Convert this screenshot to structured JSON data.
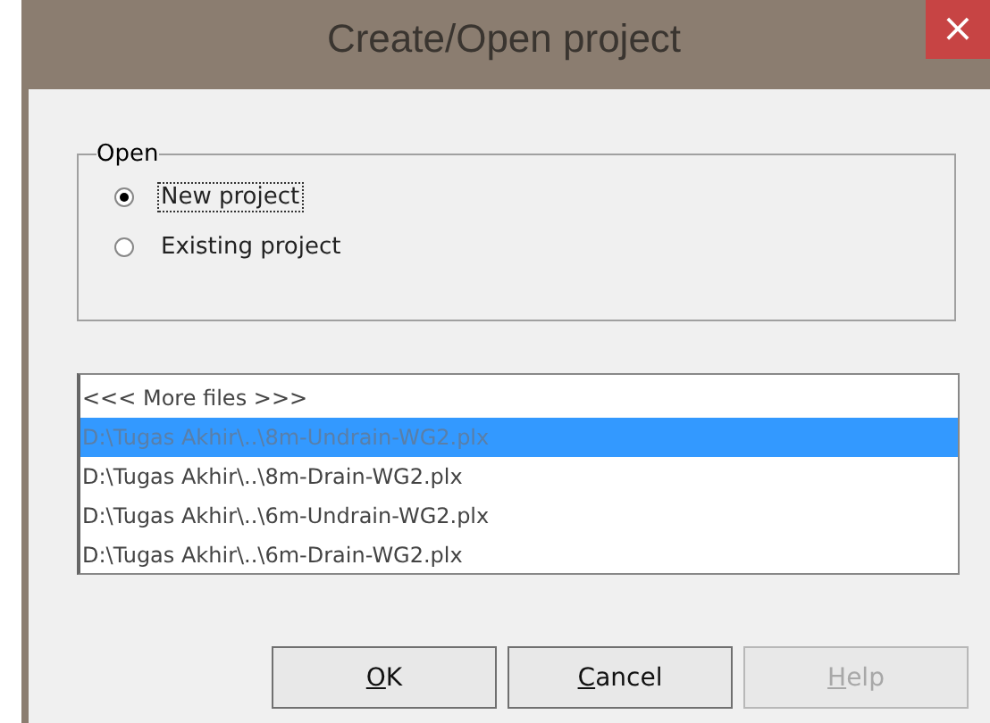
{
  "window": {
    "title": "Create/Open project",
    "close": "×"
  },
  "group": {
    "label": "Open",
    "options": [
      {
        "label": "New project",
        "selected": true,
        "focused": true
      },
      {
        "label": "Existing project",
        "selected": false,
        "focused": false
      }
    ]
  },
  "files": [
    {
      "label": "<<< More files >>>",
      "selected": false
    },
    {
      "label": "D:\\Tugas Akhir\\..\\8m-Undrain-WG2.plx",
      "selected": true
    },
    {
      "label": "D:\\Tugas Akhir\\..\\8m-Drain-WG2.plx",
      "selected": false
    },
    {
      "label": "D:\\Tugas Akhir\\..\\6m-Undrain-WG2.plx",
      "selected": false
    },
    {
      "label": "D:\\Tugas Akhir\\..\\6m-Drain-WG2.plx",
      "selected": false
    }
  ],
  "buttons": [
    {
      "label": "OK",
      "disabled": false
    },
    {
      "label": "Cancel",
      "disabled": false
    },
    {
      "label": "Help",
      "disabled": true
    }
  ]
}
